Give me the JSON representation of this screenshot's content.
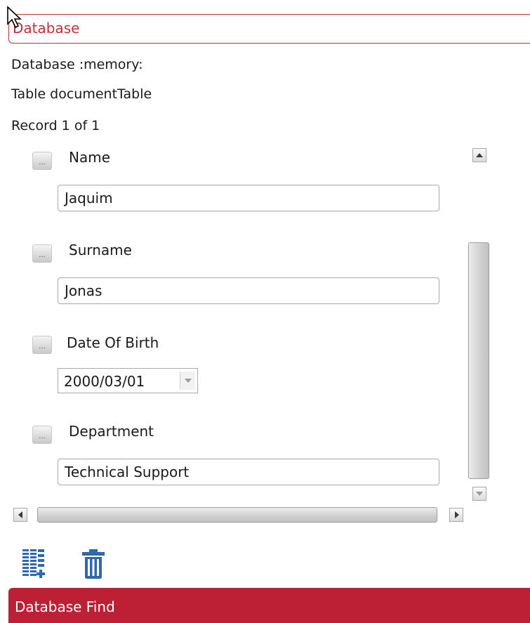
{
  "database_panel": {
    "title": "Database",
    "database_line": "Database :memory:",
    "table_line": "Table documentTable",
    "record_line": "Record 1 of 1"
  },
  "fields": {
    "name": {
      "label": "Name",
      "value": "Jaquim",
      "button_label": "..."
    },
    "surname": {
      "label": "Surname",
      "value": "Jonas",
      "button_label": "..."
    },
    "date_of_birth": {
      "label": "Date Of Birth",
      "value": "2000/03/01",
      "button_label": "..."
    },
    "department": {
      "label": "Department",
      "value": "Technical Support",
      "button_label": "..."
    }
  },
  "toolbar": {
    "icons": [
      "add-record-icon",
      "delete-icon"
    ]
  },
  "footer": {
    "find_label": "Database Find"
  },
  "colors": {
    "accent": "#c7303f",
    "find_bar": "#bd1f35",
    "icon_blue": "#2f68ad"
  }
}
